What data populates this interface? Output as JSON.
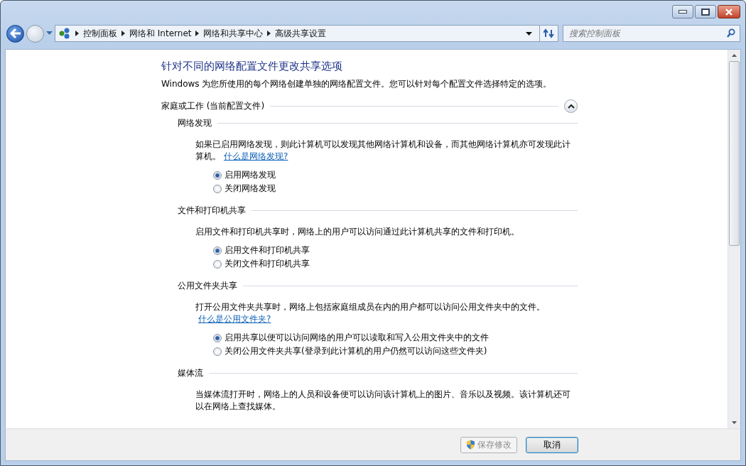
{
  "address_bar": {
    "breadcrumbs": [
      "控制面板",
      "网络和 Internet",
      "网络和共享中心",
      "高级共享设置"
    ]
  },
  "search": {
    "placeholder": "搜索控制面板"
  },
  "page": {
    "title": "针对不同的网络配置文件更改共享选项",
    "intro": "Windows 为您所使用的每个网络创建单独的网络配置文件。您可以针对每个配置文件选择特定的选项。",
    "profile": {
      "label": "家庭或工作 (当前配置文件)",
      "expanded": true
    },
    "sections": [
      {
        "title": "网络发现",
        "description": "如果已启用网络发现，则此计算机可以发现其他网络计算机和设备，而其他网络计算机亦可发现此计算机。",
        "link": "什么是网络发现?",
        "options": [
          {
            "label": "启用网络发现",
            "selected": true
          },
          {
            "label": "关闭网络发现",
            "selected": false
          }
        ]
      },
      {
        "title": "文件和打印机共享",
        "description": "启用文件和打印机共享时，网络上的用户可以访问通过此计算机共享的文件和打印机。",
        "options": [
          {
            "label": "启用文件和打印机共享",
            "selected": true
          },
          {
            "label": "关闭文件和打印机共享",
            "selected": false
          }
        ]
      },
      {
        "title": "公用文件夹共享",
        "description": "打开公用文件夹共享时，网络上包括家庭组成员在内的用户都可以访问公用文件夹中的文件。",
        "link": "什么是公用文件夹?",
        "options": [
          {
            "label": "启用共享以便可以访问网络的用户可以读取和写入公用文件夹中的文件",
            "selected": true
          },
          {
            "label": "关闭公用文件夹共享(登录到此计算机的用户仍然可以访问这些文件夹)",
            "selected": false
          }
        ]
      },
      {
        "title": "媒体流",
        "description": "当媒体流打开时，网络上的人员和设备便可以访问该计算机上的图片、音乐以及视频。该计算机还可以在网络上查找媒体。"
      }
    ]
  },
  "footer": {
    "buttons": [
      {
        "label": "保存修改",
        "disabled": true,
        "shield": true
      },
      {
        "label": "取消",
        "disabled": false,
        "shield": false
      }
    ]
  }
}
